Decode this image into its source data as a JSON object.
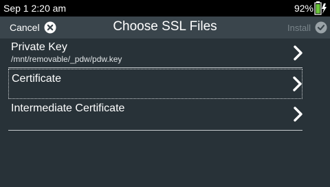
{
  "status_bar": {
    "time": "Sep 1 2:20 am",
    "battery_percent": "92%"
  },
  "header": {
    "cancel_label": "Cancel",
    "title": "Choose SSL Files",
    "install_label": "Install"
  },
  "items": [
    {
      "label": "Private Key",
      "path": "/mnt/removable/_pdw/pdw.key"
    },
    {
      "label": "Certificate"
    },
    {
      "label": "Intermediate Certificate"
    }
  ],
  "icons": {
    "cancel": "close-circle-icon",
    "install": "check-circle-icon",
    "battery": "battery-charging-icon",
    "row_arrow": "chevron-right-icon"
  },
  "colors": {
    "background": "#283238",
    "title_bar": "#3a454c",
    "status_bar": "#000000",
    "battery_fill": "#6ac53a",
    "disabled_text": "#7a858b"
  }
}
